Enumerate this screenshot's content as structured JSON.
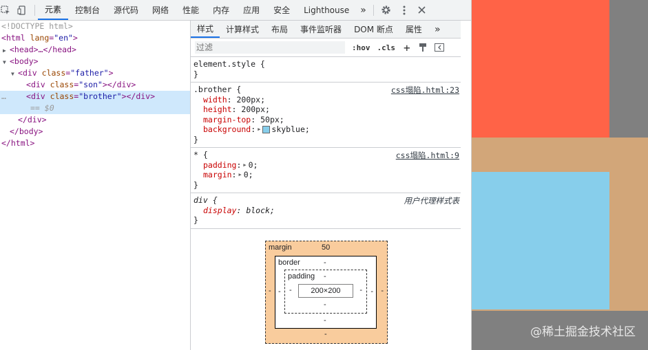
{
  "toolbar": {
    "tabs": [
      "元素",
      "控制台",
      "源代码",
      "网络",
      "性能",
      "内存",
      "应用",
      "安全",
      "Lighthouse"
    ],
    "more": "»"
  },
  "elements": {
    "doctype": "<!DOCTYPE html>",
    "html_open_tag": "html",
    "html_attr": "lang",
    "html_attr_val": "\"en\"",
    "head_collapsed": "<head>…</head>",
    "body_open": "<body>",
    "father_tag": "div",
    "father_attr": "class",
    "father_val": "\"father\"",
    "son_tag": "div",
    "son_attr": "class",
    "son_val": "\"son\"",
    "brother_tag": "div",
    "brother_attr": "class",
    "brother_val": "\"brother\"",
    "selected_marker": "== $0",
    "div_close": "</div>",
    "body_close": "</body>",
    "html_close": "</html>",
    "dots": "…"
  },
  "styles_tabs": [
    "样式",
    "计算样式",
    "布局",
    "事件监听器",
    "DOM 断点",
    "属性"
  ],
  "filter": {
    "placeholder": "过滤",
    "hov": ":hov",
    "cls": ".cls",
    "plus": "+"
  },
  "rules": [
    {
      "selector": "element.style {",
      "source": "",
      "close": "}"
    },
    {
      "selector": ".brother {",
      "source": "css塌陷.html:23",
      "props": [
        {
          "name": "width",
          "value": "200px;"
        },
        {
          "name": "height",
          "value": "200px;"
        },
        {
          "name": "margin-top",
          "value": "50px;"
        },
        {
          "name": "background",
          "value": "skyblue;"
        }
      ],
      "close": "}"
    },
    {
      "selector": "* {",
      "source": "css塌陷.html:9",
      "props": [
        {
          "name": "padding",
          "value": "0;"
        },
        {
          "name": "margin",
          "value": "0;"
        }
      ],
      "close": "}"
    },
    {
      "selector": "div {",
      "source": "用户代理样式表",
      "props": [
        {
          "name": "display",
          "value": "block;"
        }
      ],
      "close": "}"
    }
  ],
  "box_model": {
    "margin_label": "margin",
    "margin_top": "50",
    "margin_left": "-",
    "margin_right": "-",
    "margin_bottom": "-",
    "border_label": "border",
    "border_top": "-",
    "border_left": "-",
    "border_right": "-",
    "border_bottom": "-",
    "padding_label": "padding",
    "padding_top": "-",
    "padding_left": "-",
    "padding_right": "-",
    "padding_bottom": "-",
    "content": "200×200"
  },
  "preview": {
    "watermark": "@稀土掘金技术社区",
    "colors": {
      "son": "#ff6347",
      "father": "#d2a679",
      "brother": "#87ceeb",
      "body": "#808080"
    }
  }
}
